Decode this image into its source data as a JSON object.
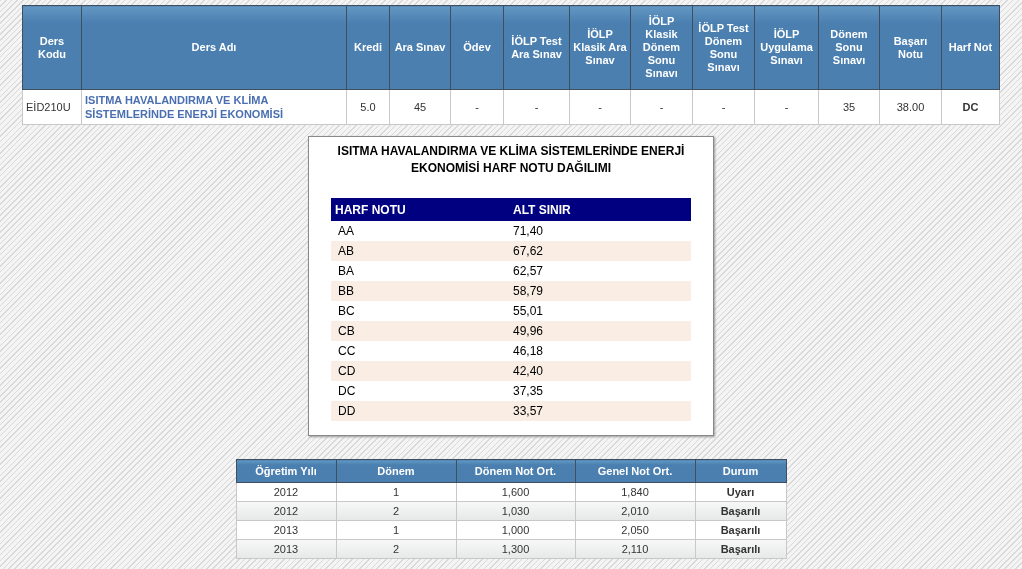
{
  "course_table": {
    "columns": [
      "Ders Kodu",
      "Ders Adı",
      "Kredi",
      "Ara Sınav",
      "Ödev",
      "İÖLP Test Ara Sınav",
      "İÖLP Klasik Ara Sınav",
      "İÖLP Klasik Dönem Sonu Sınavı",
      "İÖLP Test Dönem Sonu Sınavı",
      "İÖLP Uygulama Sınavı",
      "Dönem Sonu Sınavı",
      "Başarı Notu",
      "Harf Not"
    ],
    "rows": [
      {
        "cells": [
          {
            "text": "EİD210U",
            "kind": "code"
          },
          {
            "text": "ISITMA HAVALANDIRMA VE KLİMA SİSTEMLERİNDE ENERJİ EKONOMİSİ",
            "kind": "link"
          },
          {
            "text": "5.0",
            "kind": "num"
          },
          {
            "text": "45",
            "kind": "num"
          },
          {
            "text": "-",
            "kind": "num"
          },
          {
            "text": "-",
            "kind": "num"
          },
          {
            "text": "-",
            "kind": "num"
          },
          {
            "text": "-",
            "kind": "num"
          },
          {
            "text": "-",
            "kind": "num"
          },
          {
            "text": "-",
            "kind": "num"
          },
          {
            "text": "35",
            "kind": "num"
          },
          {
            "text": "38.00",
            "kind": "num"
          },
          {
            "text": "DC",
            "kind": "bold"
          }
        ]
      }
    ]
  },
  "distribution": {
    "title": "ISITMA HAVALANDIRMA VE KLİMA SİSTEMLERİNDE ENERJİ EKONOMİSİ HARF NOTU DAĞILIMI",
    "columns": [
      "HARF NOTU",
      "ALT SINIR"
    ],
    "rows": [
      [
        "AA",
        "71,40"
      ],
      [
        "AB",
        "67,62"
      ],
      [
        "BA",
        "62,57"
      ],
      [
        "BB",
        "58,79"
      ],
      [
        "BC",
        "55,01"
      ],
      [
        "CB",
        "49,96"
      ],
      [
        "CC",
        "46,18"
      ],
      [
        "CD",
        "42,40"
      ],
      [
        "DC",
        "37,35"
      ],
      [
        "DD",
        "33,57"
      ]
    ]
  },
  "term_table": {
    "columns": [
      "Öğretim Yılı",
      "Dönem",
      "Dönem Not Ort.",
      "Genel Not Ort.",
      "Durum"
    ],
    "rows": [
      [
        "2012",
        "1",
        "1,600",
        "1,840",
        "Uyarı"
      ],
      [
        "2012",
        "2",
        "1,030",
        "2,010",
        "Başarılı"
      ],
      [
        "2013",
        "1",
        "1,000",
        "2,050",
        "Başarılı"
      ],
      [
        "2013",
        "2",
        "1,300",
        "2,110",
        "Başarılı"
      ]
    ]
  }
}
